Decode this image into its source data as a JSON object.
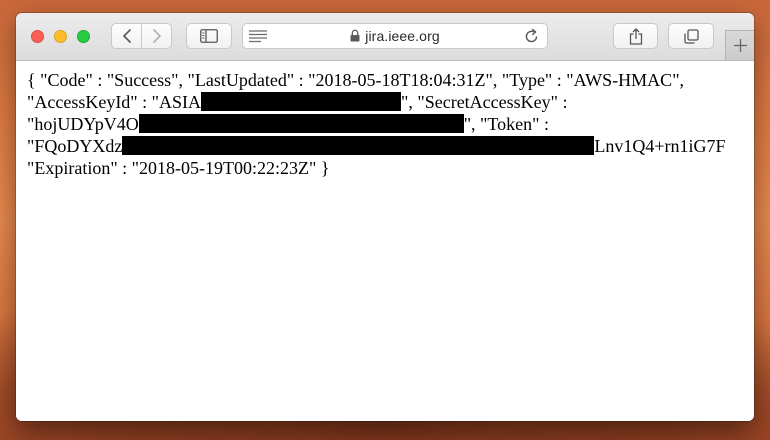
{
  "browser": {
    "url": "jira.ieee.org",
    "icons": {
      "back": "chevron-left-icon",
      "forward": "chevron-right-icon",
      "sidebar": "sidebar-icon",
      "reader": "reader-view-icon",
      "lock": "lock-icon",
      "reload": "reload-icon",
      "share": "share-icon",
      "tabs": "tab-overview-icon",
      "new_tab": "plus-icon"
    },
    "traffic_lights": {
      "close": "#fc5f57",
      "minimize": "#fdbc2e",
      "zoom": "#29c941"
    }
  },
  "document": {
    "line1": "{ \"Code\" : \"Success\", \"LastUpdated\" : \"2018-05-18T18:04:31Z\", \"Type\" : \"AWS-HMAC\",",
    "line2_prefix": "\"AccessKeyId\" : \"ASIA",
    "line2_suffix": "\", \"SecretAccessKey\" :",
    "line3_prefix": "\"hojUDYpV4O",
    "line3_suffix": "\", \"Token\" :",
    "line4_prefix": "\"FQoDYXdz",
    "line4_suffix": "Lnv1Q4+rn1iG7F",
    "line5": "\"Expiration\" : \"2018-05-19T00:22:23Z\" }",
    "redaction_color": "#000000"
  }
}
